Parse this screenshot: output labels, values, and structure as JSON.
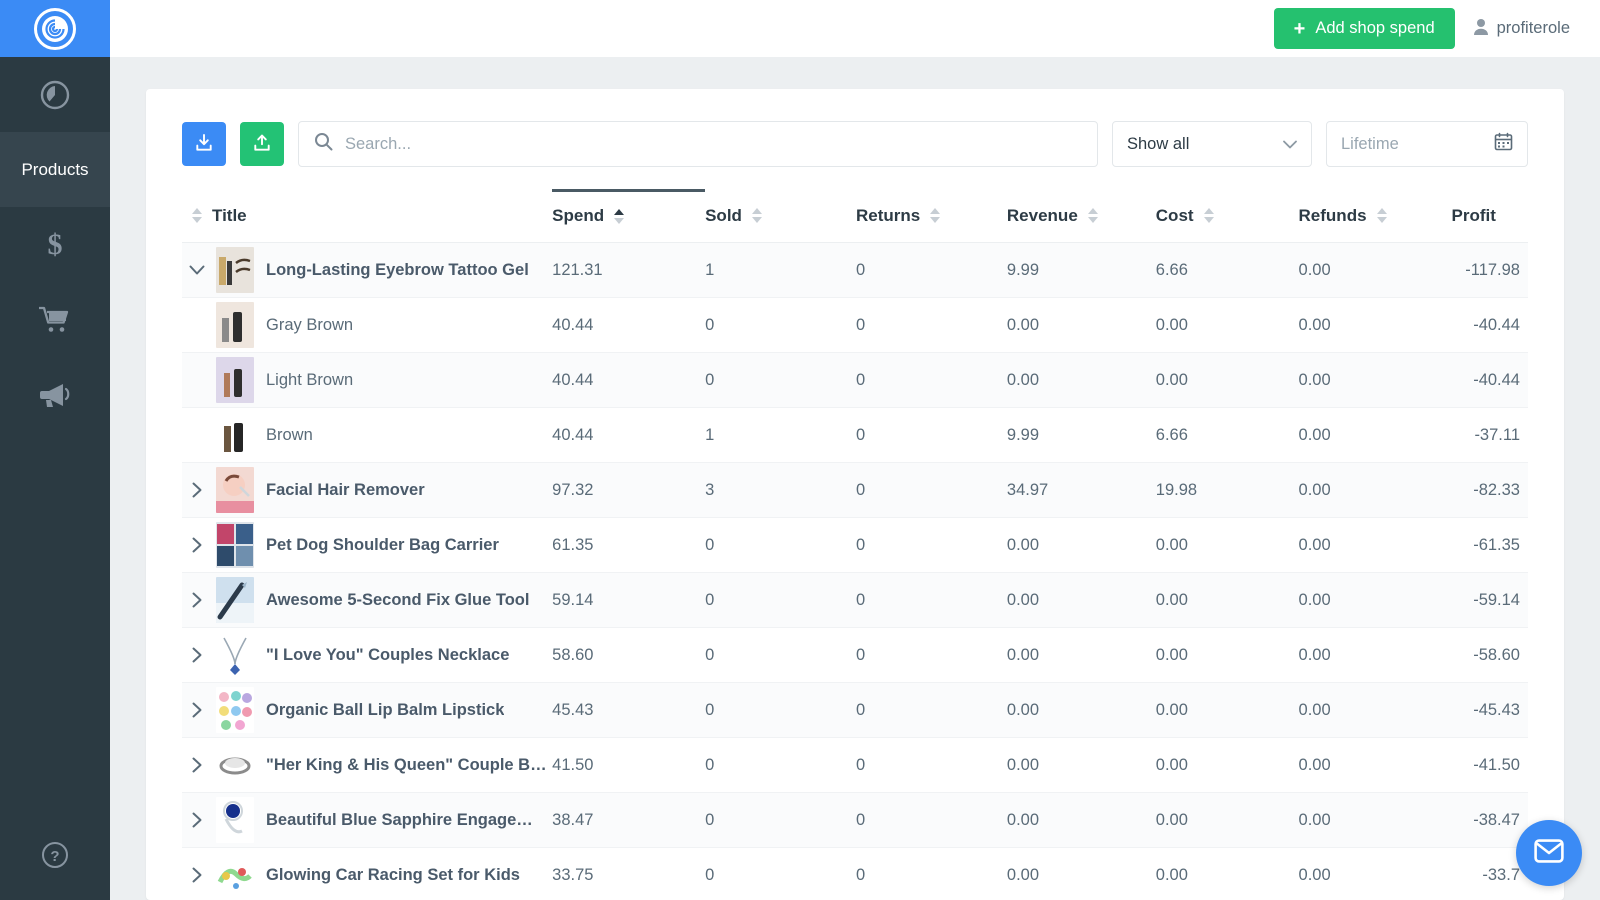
{
  "brand": {
    "logo_name": "swirl-logo",
    "logo_bg": "#3b8bf5"
  },
  "sidebar": {
    "items": [
      {
        "icon": "dashboard-gauge-icon",
        "label": "",
        "active": false
      },
      {
        "icon": "products-icon",
        "label": "Products",
        "active": true
      },
      {
        "icon": "dollar-icon",
        "label": "",
        "active": false
      },
      {
        "icon": "shopping-cart-icon",
        "label": "",
        "active": false
      },
      {
        "icon": "megaphone-icon",
        "label": "",
        "active": false
      }
    ],
    "help_label": "?"
  },
  "topbar": {
    "add_spend_label": "Add shop spend",
    "add_spend_color": "#25c16f",
    "plus_glyph": "+",
    "username": "profiterole"
  },
  "toolbar": {
    "download_title": "download",
    "upload_title": "upload",
    "download_color": "#3b8bf5",
    "upload_color": "#23c275",
    "search": {
      "value": "",
      "placeholder": "Search..."
    },
    "filter_select": {
      "value": "Show all"
    },
    "date_range": {
      "value": "",
      "placeholder": "Lifetime"
    }
  },
  "table": {
    "columns": [
      {
        "label": "Title",
        "sortable": true,
        "sorted": false,
        "dir": ""
      },
      {
        "label": "Spend",
        "sortable": true,
        "sorted": true,
        "dir": "asc"
      },
      {
        "label": "Sold",
        "sortable": true,
        "sorted": false,
        "dir": ""
      },
      {
        "label": "Returns",
        "sortable": true,
        "sorted": false,
        "dir": ""
      },
      {
        "label": "Revenue",
        "sortable": true,
        "sorted": false,
        "dir": ""
      },
      {
        "label": "Cost",
        "sortable": true,
        "sorted": false,
        "dir": ""
      },
      {
        "label": "Refunds",
        "sortable": true,
        "sorted": false,
        "dir": ""
      },
      {
        "label": "Profit",
        "sortable": true,
        "sorted": false,
        "dir": ""
      }
    ],
    "rows": [
      {
        "type": "parent",
        "expanded": true,
        "title": "Long-Lasting Eyebrow Tattoo Gel",
        "spend": "121.31",
        "sold": "1",
        "returns": "0",
        "revenue": "9.99",
        "cost": "6.66",
        "refunds": "0.00",
        "profit": "-117.98",
        "thumb": "eyebrow-gel-kit"
      },
      {
        "type": "variant",
        "expanded": false,
        "title": "Gray Brown",
        "spend": "40.44",
        "sold": "0",
        "returns": "0",
        "revenue": "0.00",
        "cost": "0.00",
        "refunds": "0.00",
        "profit": "-40.44",
        "thumb": "mascara-gray"
      },
      {
        "type": "variant",
        "expanded": false,
        "title": "Light Brown",
        "spend": "40.44",
        "sold": "0",
        "returns": "0",
        "revenue": "0.00",
        "cost": "0.00",
        "refunds": "0.00",
        "profit": "-40.44",
        "thumb": "mascara-light"
      },
      {
        "type": "variant",
        "expanded": false,
        "title": "Brown",
        "spend": "40.44",
        "sold": "1",
        "returns": "0",
        "revenue": "9.99",
        "cost": "6.66",
        "refunds": "0.00",
        "profit": "-37.11",
        "thumb": "mascara-brown"
      },
      {
        "type": "parent",
        "expanded": false,
        "title": "Facial Hair Remover",
        "spend": "97.32",
        "sold": "3",
        "returns": "0",
        "revenue": "34.97",
        "cost": "19.98",
        "refunds": "0.00",
        "profit": "-82.33",
        "thumb": "face-woman"
      },
      {
        "type": "parent",
        "expanded": false,
        "title": "Pet Dog Shoulder Bag Carrier",
        "spend": "61.35",
        "sold": "0",
        "returns": "0",
        "revenue": "0.00",
        "cost": "0.00",
        "refunds": "0.00",
        "profit": "-61.35",
        "thumb": "pet-bags"
      },
      {
        "type": "parent",
        "expanded": false,
        "title": "Awesome 5-Second Fix Glue Tool",
        "spend": "59.14",
        "sold": "0",
        "returns": "0",
        "revenue": "0.00",
        "cost": "0.00",
        "refunds": "0.00",
        "profit": "-59.14",
        "thumb": "glue-pen"
      },
      {
        "type": "parent",
        "expanded": false,
        "title": "\"I Love You\" Couples Necklace",
        "spend": "58.60",
        "sold": "0",
        "returns": "0",
        "revenue": "0.00",
        "cost": "0.00",
        "refunds": "0.00",
        "profit": "-58.60",
        "thumb": "necklace"
      },
      {
        "type": "parent",
        "expanded": false,
        "title": "Organic Ball Lip Balm Lipstick",
        "spend": "45.43",
        "sold": "0",
        "returns": "0",
        "revenue": "0.00",
        "cost": "0.00",
        "refunds": "0.00",
        "profit": "-45.43",
        "thumb": "lip-balms"
      },
      {
        "type": "parent",
        "expanded": false,
        "title": "\"Her King & His Queen\" Couple B…",
        "spend": "41.50",
        "sold": "0",
        "returns": "0",
        "revenue": "0.00",
        "cost": "0.00",
        "refunds": "0.00",
        "profit": "-41.50",
        "thumb": "ring-pair"
      },
      {
        "type": "parent",
        "expanded": false,
        "title": "Beautiful Blue Sapphire Engage…",
        "spend": "38.47",
        "sold": "0",
        "returns": "0",
        "revenue": "0.00",
        "cost": "0.00",
        "refunds": "0.00",
        "profit": "-38.47",
        "thumb": "sapphire-ring"
      },
      {
        "type": "parent",
        "expanded": false,
        "title": "Glowing Car Racing Set for Kids",
        "spend": "33.75",
        "sold": "0",
        "returns": "0",
        "revenue": "0.00",
        "cost": "0.00",
        "refunds": "0.00",
        "profit": "-33.7",
        "thumb": "car-track"
      }
    ]
  },
  "chat": {
    "icon": "envelope-icon",
    "color": "#3b8bf5"
  }
}
